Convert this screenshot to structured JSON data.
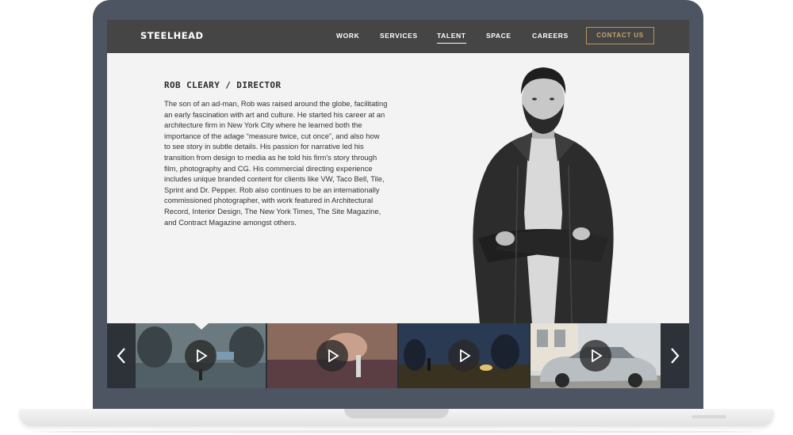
{
  "nav": {
    "logo": "STEELHEAD",
    "items": [
      {
        "label": "WORK",
        "active": false
      },
      {
        "label": "SERVICES",
        "active": false
      },
      {
        "label": "TALENT",
        "active": true
      },
      {
        "label": "SPACE",
        "active": false
      },
      {
        "label": "CAREERS",
        "active": false
      }
    ],
    "contact_label": "CONTACT US"
  },
  "bio": {
    "title": "ROB CLEARY / DIRECTOR",
    "lines": [
      "The son of an ad-man, Rob was raised around the globe, facilitating",
      "an early fascination with art and culture. He started his career at an",
      "architecture firm in New York City where he learned both the",
      "importance of the adage “measure twice, cut once”, and also how",
      "to see story in subtle details. His passion for narrative led his",
      "transition from design to media as he told his firm’s story through",
      "film, photography and CG. His commercial directing experience",
      "includes unique branded content for clients like VW, Taco Bell, Tile,",
      "Sprint and Dr. Pepper. Rob also continues to be an internationally",
      "commissioned photographer, with work featured in Architectural",
      "Record, Interior Design, The New York Times, The Site Magazine,",
      "and Contract Magazine amongst others."
    ]
  },
  "colors": {
    "bezel": "#4d5562",
    "navbar": "#454545",
    "accent": "#b8955e",
    "page_bg": "#f3f3f3"
  },
  "icons": {
    "prev": "chevron-left-icon",
    "next": "chevron-right-icon",
    "play": "play-icon"
  }
}
